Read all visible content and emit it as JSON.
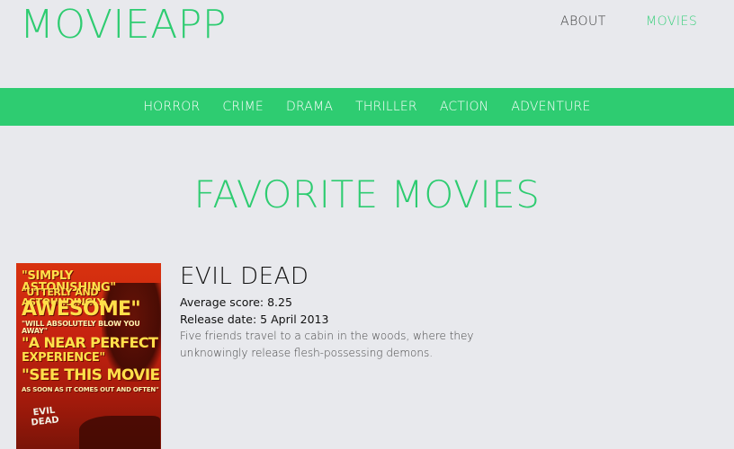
{
  "header": {
    "logo": "MOVIEAPP",
    "nav": [
      {
        "label": "ABOUT",
        "active": false
      },
      {
        "label": "MOVIES",
        "active": true
      }
    ]
  },
  "genres": [
    "HORROR",
    "CRIME",
    "DRAMA",
    "THRILLER",
    "ACTION",
    "ADVENTURE"
  ],
  "section_title": "FAVORITE MOVIES",
  "movie": {
    "title": "EVIL DEAD",
    "average_score": "Average score: 8.25",
    "release_date": "Release date: 5 April 2013",
    "description": "Five friends travel to a cabin in the woods, where they unknowingly release flesh-possessing demons.",
    "poster": {
      "quotes": [
        "\"SIMPLY ASTONISHING\"",
        "\"UTTERLY AND ASTOUNDINGLY",
        "AWESOME\"",
        "\"WILL ABSOLUTELY BLOW YOU AWAY\"",
        "\"A NEAR PERFECT",
        "EXPERIENCE\"",
        "\"SEE THIS MOVIE",
        "AS SOON AS IT COMES OUT AND OFTEN\""
      ],
      "logo_text": "EVIL DEAD"
    }
  },
  "colors": {
    "accent": "#2ecc71",
    "background": "#e8e9ed"
  }
}
